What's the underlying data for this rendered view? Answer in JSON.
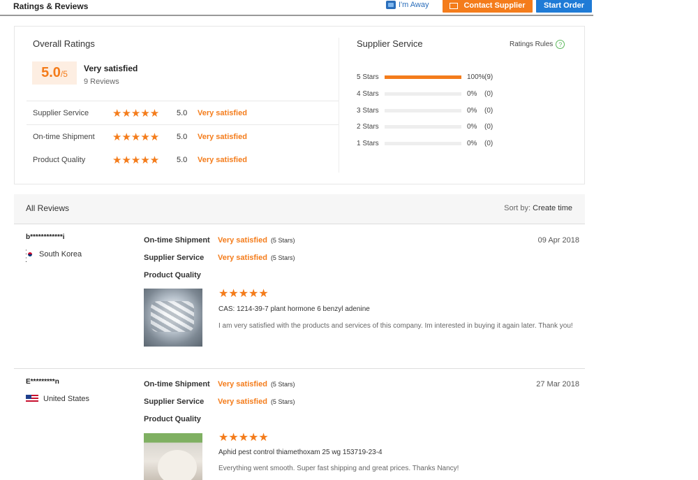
{
  "header": {
    "title": "Ratings & Reviews",
    "away_label": "I'm Away",
    "contact_label": "Contact Supplier",
    "start_order_label": "Start Order"
  },
  "overall": {
    "title": "Overall Ratings",
    "score": "5.0",
    "score_max": "/5",
    "summary": "Very satisfied",
    "reviews_count": "9 Reviews",
    "metrics": [
      {
        "label": "Supplier Service",
        "stars": "★★★★★",
        "score": "5.0",
        "rating": "Very satisfied"
      },
      {
        "label": "On-time Shipment",
        "stars": "★★★★★",
        "score": "5.0",
        "rating": "Very satisfied"
      },
      {
        "label": "Product Quality",
        "stars": "★★★★★",
        "score": "5.0",
        "rating": "Very satisfied"
      }
    ]
  },
  "supplier_service": {
    "title": "Supplier Service",
    "rules_label": "Ratings Rules",
    "rules_icon": "?",
    "bars": [
      {
        "label": "5 Stars",
        "pct": "100%",
        "count": "(9)",
        "fraction": 1.0
      },
      {
        "label": "4 Stars",
        "pct": "0%",
        "count": "(0)",
        "fraction": 0
      },
      {
        "label": "3 Stars",
        "pct": "0%",
        "count": "(0)",
        "fraction": 0
      },
      {
        "label": "2 Stars",
        "pct": "0%",
        "count": "(0)",
        "fraction": 0
      },
      {
        "label": "1 Stars",
        "pct": "0%",
        "count": "(0)",
        "fraction": 0
      }
    ]
  },
  "all_reviews": {
    "title": "All Reviews",
    "sort_prefix": "Sort by:",
    "sort_value": "Create time"
  },
  "reviews": [
    {
      "name": "b************i",
      "country": "South Korea",
      "date": "09 Apr 2018",
      "shipment_label": "On-time Shipment",
      "shipment_value": "Very satisfied",
      "shipment_stars": "(5 Stars)",
      "service_label": "Supplier Service",
      "service_value": "Very satisfied",
      "service_stars": "(5 Stars)",
      "quality_label": "Product Quality",
      "stars": "★★★★★",
      "product": "CAS: 1214-39-7 plant hormone 6 benzyl adenine",
      "text": "I am very satisfied with the products and services of this company. Im interested in buying it again later. Thank you!"
    },
    {
      "name": "E*********n",
      "country": "United States",
      "date": "27 Mar 2018",
      "shipment_label": "On-time Shipment",
      "shipment_value": "Very satisfied",
      "shipment_stars": "(5 Stars)",
      "service_label": "Supplier Service",
      "service_value": "Very satisfied",
      "service_stars": "(5 Stars)",
      "quality_label": "Product Quality",
      "stars": "★★★★★",
      "product": "Aphid pest control thiamethoxam 25 wg 153719-23-4",
      "text": "Everything went smooth. Super fast shipping and great prices. Thanks Nancy!"
    }
  ]
}
